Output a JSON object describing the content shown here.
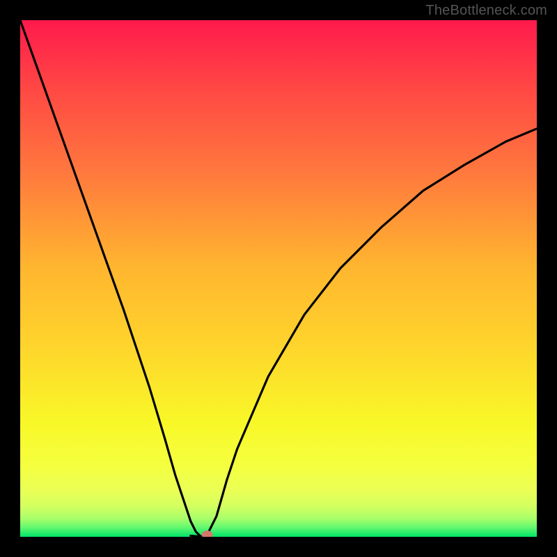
{
  "watermark": "TheBottleneck.com",
  "chart_data": {
    "type": "line",
    "title": "",
    "xlabel": "",
    "ylabel": "",
    "xlim": [
      0,
      100
    ],
    "ylim": [
      0,
      100
    ],
    "grid": false,
    "legend": false,
    "background_gradient": {
      "top_color": "#ff1a4c",
      "mid_colors": [
        "#ff7a3d",
        "#ffd22c",
        "#f8ff27",
        "#e0ff5c",
        "#8cff71"
      ],
      "bottom_color": "#00e56a"
    },
    "series": [
      {
        "name": "bottleneck-curve",
        "type": "line",
        "color": "#000000",
        "x": [
          0,
          5,
          10,
          15,
          20,
          25,
          28,
          30,
          32,
          33,
          34,
          35,
          35.5,
          36,
          38,
          40,
          42,
          48,
          55,
          62,
          70,
          78,
          86,
          94,
          100
        ],
        "values": [
          100,
          86,
          72,
          58,
          44,
          29,
          19,
          12,
          6,
          3,
          1,
          0,
          0,
          0,
          4,
          11,
          17,
          31,
          43,
          52,
          60,
          67,
          72,
          76.5,
          79
        ]
      },
      {
        "name": "bottom-plateau",
        "type": "line",
        "color": "#000000",
        "x": [
          33,
          34,
          35,
          35.5,
          36
        ],
        "values": [
          0.2,
          0.1,
          0.1,
          0.1,
          0.2
        ]
      }
    ],
    "marker": {
      "name": "optimal-point",
      "x": 36.2,
      "y": 0.4,
      "color": "#d4776a",
      "rx": 8,
      "ry": 6
    }
  }
}
